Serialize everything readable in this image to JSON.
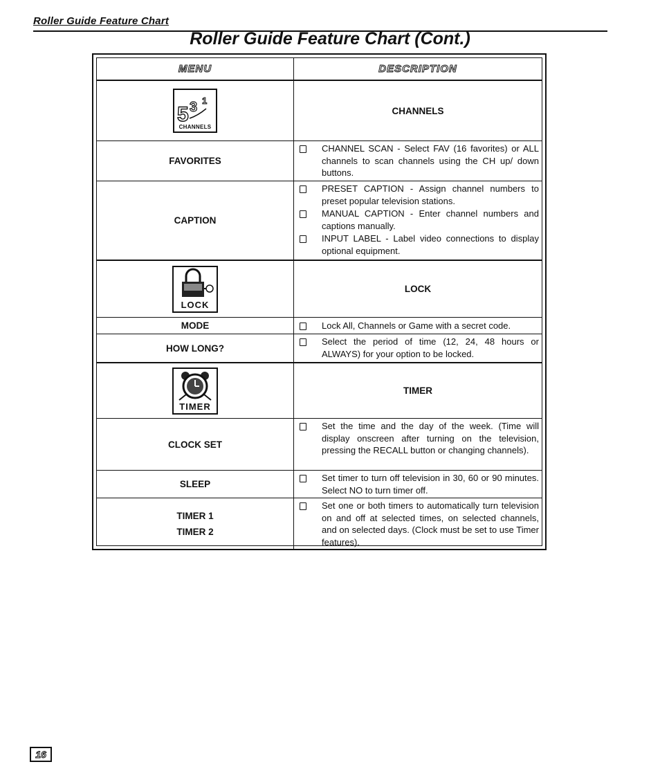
{
  "section_heading": "Roller Guide Feature Chart",
  "page_title": "Roller Guide Feature Chart (Cont.)",
  "table": {
    "header": {
      "menu": "MENU",
      "description": "DESCRIPTION"
    },
    "groups": [
      {
        "icon": "channels-icon",
        "icon_caption": "CHANNELS",
        "title": "CHANNELS",
        "rows": [
          {
            "menu": [
              "FAVORITES"
            ],
            "bullets": [
              "CHANNEL SCAN - Select FAV (16 favorites) or ALL channels to scan channels using the CH up/ down buttons."
            ]
          },
          {
            "menu": [
              "CAPTION"
            ],
            "bullets": [
              "PRESET CAPTION - Assign channel numbers to preset popular television stations.",
              "MANUAL CAPTION - Enter channel numbers and captions manually.",
              "INPUT LABEL - Label video connections to display optional equipment."
            ]
          }
        ]
      },
      {
        "icon": "lock-icon",
        "icon_caption": "LOCK",
        "title": "LOCK",
        "rows": [
          {
            "menu": [
              "MODE"
            ],
            "bullets": [
              "Lock All, Channels or Game with a secret code."
            ]
          },
          {
            "menu": [
              "HOW LONG?"
            ],
            "bullets": [
              "Select the period of time (12, 24, 48 hours or ALWAYS) for your option to be locked."
            ]
          }
        ]
      },
      {
        "icon": "timer-icon",
        "icon_caption": "TIMER",
        "title": "TIMER",
        "rows": [
          {
            "menu": [
              "CLOCK SET"
            ],
            "bullets": [
              "Set the time and the day of the week. (Time will display onscreen after turning on the television, pressing the RECALL button or changing channels)."
            ]
          },
          {
            "menu": [
              "SLEEP"
            ],
            "bullets": [
              "Set timer to turn off television in 30, 60 or 90 minutes. Select NO to turn timer off."
            ]
          },
          {
            "menu": [
              "TIMER 1",
              "TIMER 2"
            ],
            "bullets": [
              "Set one or both timers to automatically turn television on and off at selected times, on selected channels, and on selected days. (Clock must be set to use Timer features)."
            ]
          }
        ]
      }
    ]
  },
  "page_number": "16"
}
